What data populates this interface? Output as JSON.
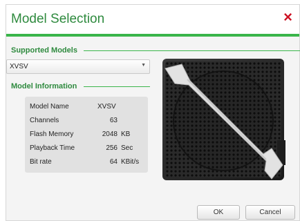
{
  "dialog": {
    "title": "Model Selection",
    "close_icon": "×"
  },
  "supported_models": {
    "heading": "Supported Models",
    "selected": "XVSV"
  },
  "model_information": {
    "heading": "Model Information",
    "rows": [
      {
        "label": "Model Name",
        "value": "XVSV",
        "unit": ""
      },
      {
        "label": "Channels",
        "value": "63",
        "unit": ""
      },
      {
        "label": "Flash Memory",
        "value": "2048",
        "unit": "KB"
      },
      {
        "label": "Playback Time",
        "value": "256",
        "unit": "Sec"
      },
      {
        "label": "Bit rate",
        "value": "64",
        "unit": "KBit/s"
      }
    ]
  },
  "buttons": {
    "ok": "OK",
    "cancel": "Cancel"
  },
  "colors": {
    "accent": "#3ab54a",
    "title_text": "#2e8a3e",
    "close": "#cc1122"
  }
}
